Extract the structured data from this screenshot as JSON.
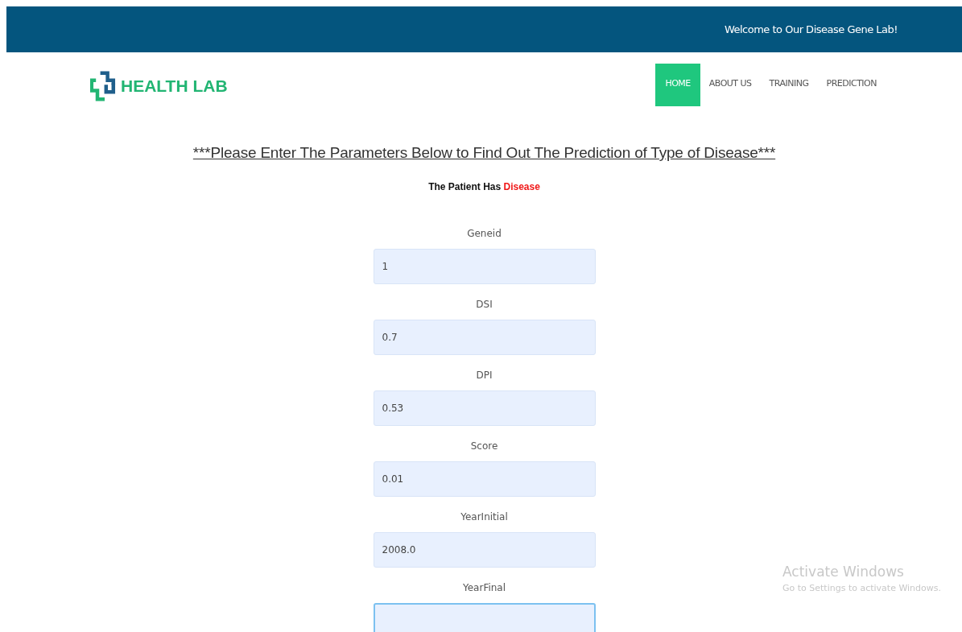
{
  "top_bar": {
    "text": "Welcome to Our Disease Gene Lab!"
  },
  "logo": {
    "text": "HEALTH LAB"
  },
  "nav": [
    {
      "label": "HOME",
      "selected": true
    },
    {
      "label": "ABOUT US",
      "selected": false
    },
    {
      "label": "TRAINING",
      "selected": false
    },
    {
      "label": "PREDICTION",
      "selected": false
    }
  ],
  "heading": "***Please Enter The Parameters Below to Find Out The Prediction of Type of Disease***",
  "result": "The Patient Has ",
  "result_value": "Disease",
  "fields": [
    {
      "label": "Geneid",
      "value": "1",
      "focused": false
    },
    {
      "label": "DSI",
      "value": "0.7",
      "focused": false
    },
    {
      "label": "DPI",
      "value": "0.53",
      "focused": false
    },
    {
      "label": "Score",
      "value": "0.01",
      "focused": false
    },
    {
      "label": "YearInitial",
      "value": "2008.0",
      "focused": false
    },
    {
      "label": "YearFinal",
      "focused": true
    }
  ],
  "os_notice": {
    "title": "Activate Windows",
    "text": "Go to Settings to activate Windows."
  }
}
